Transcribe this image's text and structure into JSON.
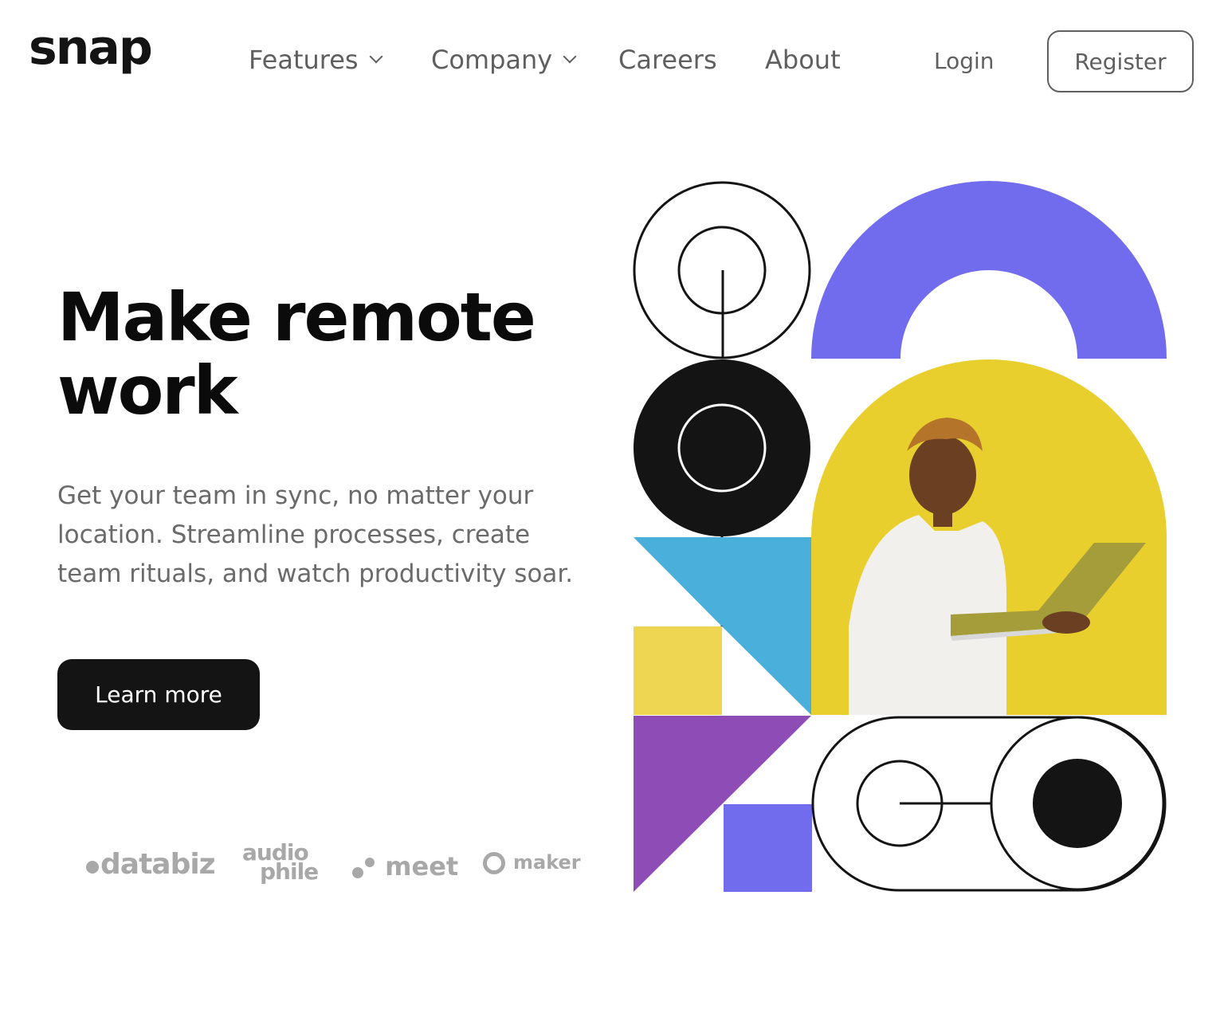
{
  "brand": {
    "logo_text": "snap"
  },
  "nav": {
    "items": [
      {
        "label": "Features",
        "has_dropdown": true
      },
      {
        "label": "Company",
        "has_dropdown": true
      },
      {
        "label": "Careers",
        "has_dropdown": false
      },
      {
        "label": "About",
        "has_dropdown": false
      }
    ],
    "login_label": "Login",
    "register_label": "Register"
  },
  "hero": {
    "headline": "Make remote work",
    "description": "Get your team in sync, no matter your location. Streamline processes, create team rituals, and watch productivity soar.",
    "cta_label": "Learn more"
  },
  "clients": {
    "databiz": "databiz",
    "audiophile_top": "audio",
    "audiophile_bottom": "phile",
    "meet": "meet",
    "maker": "maker"
  },
  "colors": {
    "accent_purple": "#716CEE",
    "yellow": "#E9CF2E",
    "blue": "#4BAFDC",
    "violet": "#8E4CB6",
    "dark": "#141414",
    "gray_text": "#6a6a6a"
  }
}
